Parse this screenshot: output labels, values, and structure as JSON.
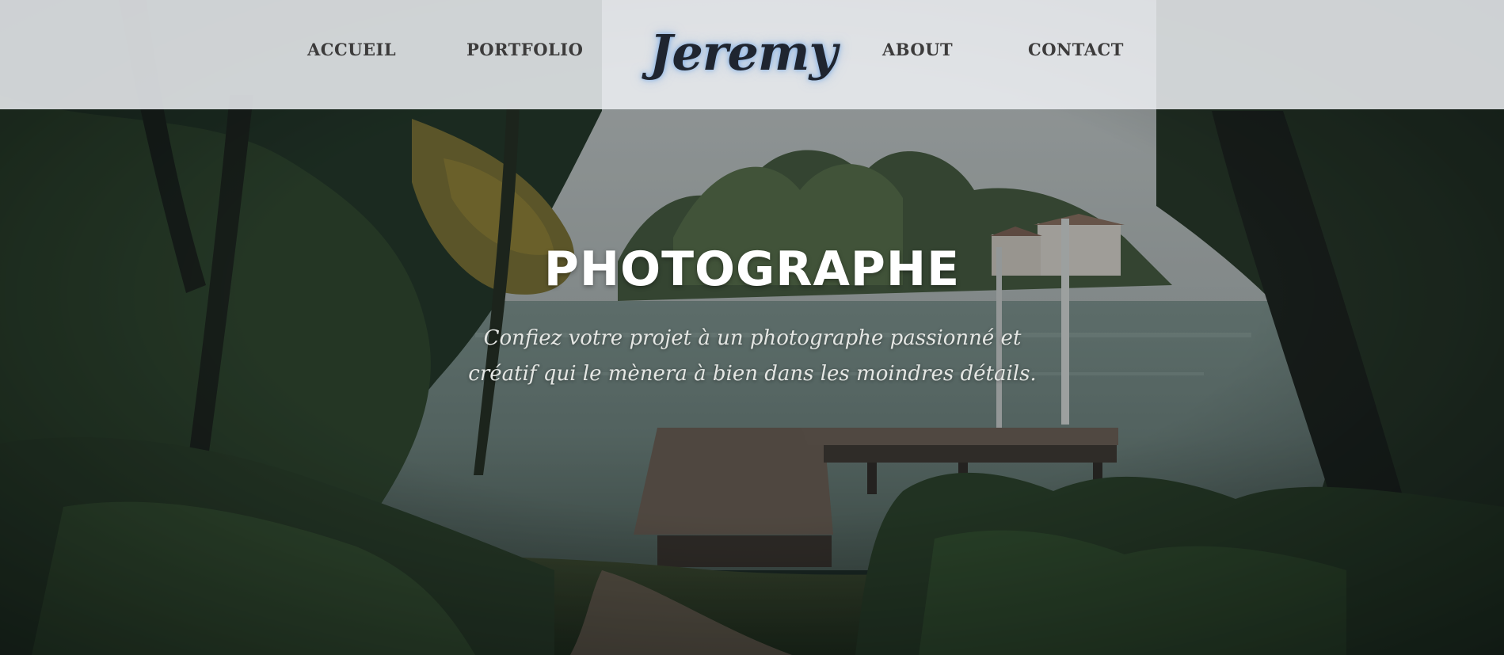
{
  "nav": {
    "items": [
      {
        "label": "ACCUEIL"
      },
      {
        "label": "PORTFOLIO"
      },
      {
        "label": "ABOUT"
      },
      {
        "label": "CONTACT"
      }
    ],
    "logo_text": "Jeremy"
  },
  "hero": {
    "title": "PHOTOGRAPHE",
    "subtitle_line1": "Confiez votre projet à un photographe passionné et",
    "subtitle_line2": "créatif qui le mènera à bien dans les moindres détails."
  },
  "colors": {
    "header_bg": "#eef0f3",
    "nav_text": "#3c3b3b",
    "logo_text": "#1f2530",
    "logo_glow": "#78aae6",
    "hero_title": "#ffffff"
  },
  "icons": {
    "hero_image": "lake-pier-photo"
  }
}
